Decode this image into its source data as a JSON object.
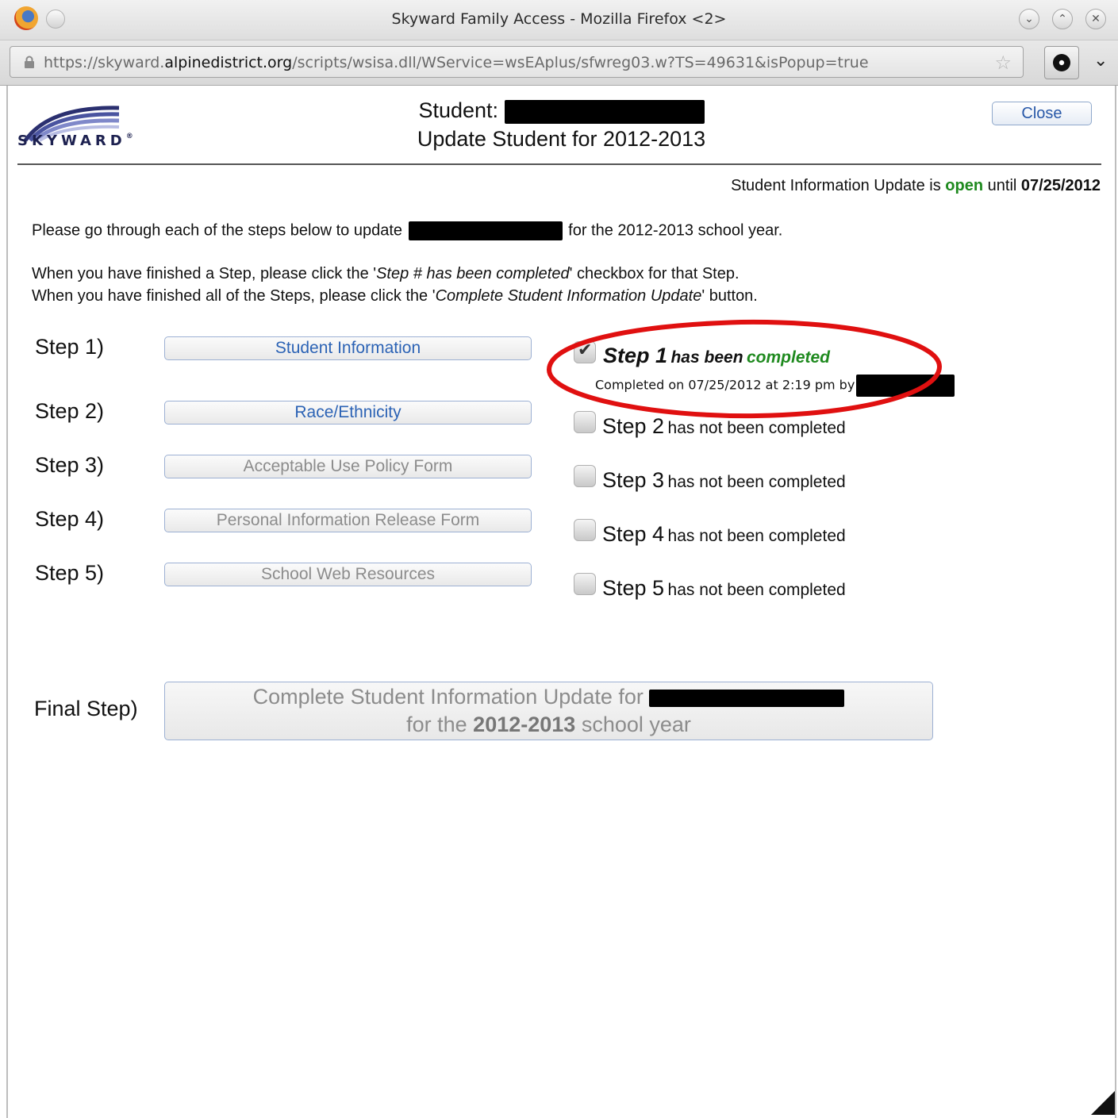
{
  "window": {
    "title": "Skyward Family Access - Mozilla Firefox <2>",
    "url_prefix": "https://skyward.",
    "url_domain": "alpinedistrict.org",
    "url_suffix": "/scripts/wsisa.dll/WService=wsEAplus/sfwreg03.w?TS=49631&isPopup=true"
  },
  "header": {
    "logo_text": "SKYWARD",
    "student_label": "Student:",
    "update_title": "Update Student for 2012-2013",
    "close_label": "Close"
  },
  "notice": {
    "prefix": "Student Information Update is ",
    "status": "open",
    "middle": " until ",
    "date": "07/25/2012"
  },
  "instructions": {
    "line1_prefix": "Please go through each of the steps below to update",
    "line1_suffix": "for the 2012-2013 school year.",
    "line2_prefix": "When you have finished a Step, please click the '",
    "line2_italic": "Step # has been completed",
    "line2_suffix": "' checkbox for that Step.",
    "line3_prefix": "When you have finished all of the Steps, please click the '",
    "line3_italic": "Complete Student Information Update",
    "line3_suffix": "' button."
  },
  "steps": [
    {
      "label": "Step 1)",
      "button": "Student Information",
      "step_word": "Step 1",
      "status_text": "has been",
      "status_done": "completed",
      "completed_info": "Completed on 07/25/2012 at 2:19 pm by",
      "checked": true,
      "enabled": true
    },
    {
      "label": "Step 2)",
      "button": "Race/Ethnicity",
      "step_word": "Step 2",
      "status_text": "has not been completed",
      "checked": false,
      "enabled": true
    },
    {
      "label": "Step 3)",
      "button": "Acceptable Use Policy Form",
      "step_word": "Step 3",
      "status_text": "has not been completed",
      "checked": false,
      "enabled": false
    },
    {
      "label": "Step 4)",
      "button": "Personal Information Release Form",
      "step_word": "Step 4",
      "status_text": "has not been completed",
      "checked": false,
      "enabled": false
    },
    {
      "label": "Step 5)",
      "button": "School Web Resources",
      "step_word": "Step 5",
      "status_text": "has not been completed",
      "checked": false,
      "enabled": false
    }
  ],
  "final": {
    "label": "Final Step)",
    "line1": "Complete Student Information Update for",
    "line2_prefix": "for the",
    "line2_bold": "2012-2013",
    "line2_suffix": "school year"
  },
  "colors": {
    "open_green": "#1f8a1f",
    "link_blue": "#2c63b5",
    "disabled_gray": "#8c8c8c",
    "annotation_red": "#e01010"
  }
}
